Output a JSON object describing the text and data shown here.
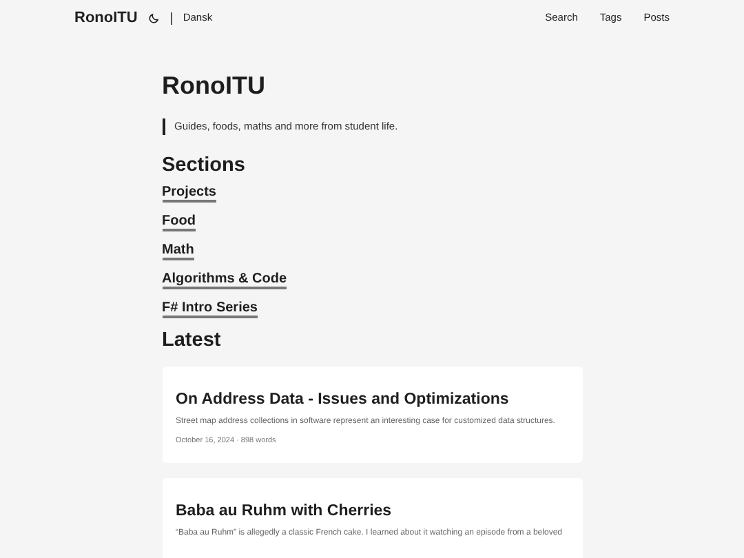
{
  "header": {
    "logo": "RonoITU",
    "language": "Dansk",
    "menu": [
      "Search",
      "Tags",
      "Posts"
    ]
  },
  "profile": {
    "title": "RonoITU",
    "subtitle": "Guides, foods, maths and more from student life."
  },
  "sections": {
    "heading": "Sections",
    "links": [
      "Projects",
      "Food",
      "Math",
      "Algorithms & Code",
      "F# Intro Series"
    ]
  },
  "latest": {
    "heading": "Latest",
    "posts": [
      {
        "title": "On Address Data - Issues and Optimizations",
        "summary": "Street map address collections in software represent an interesting case for customized data structures.",
        "meta": "October 16, 2024 · 898 words"
      },
      {
        "title": "Baba au Ruhm with Cherries",
        "summary": "“Baba au Ruhm” is allegedly a classic French cake. I learned about it watching an episode from a beloved"
      }
    ]
  }
}
